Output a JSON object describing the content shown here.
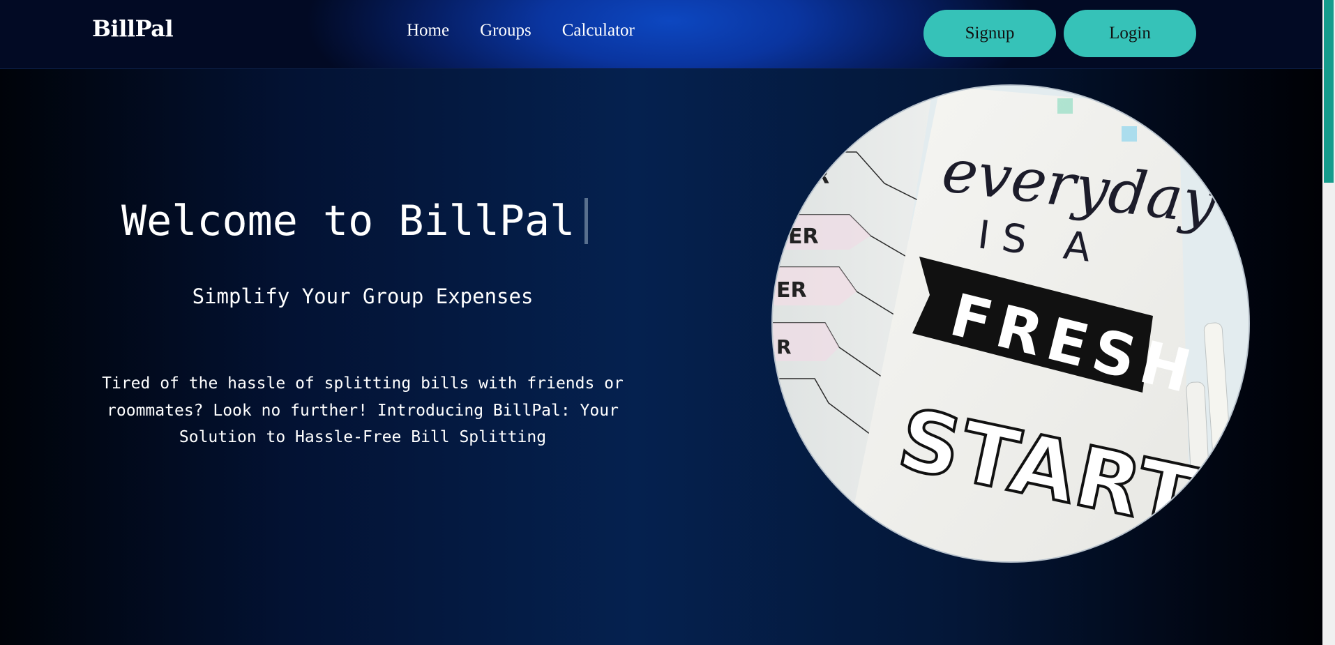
{
  "nav": {
    "brand": "BillPal",
    "links": [
      "Home",
      "Groups",
      "Calculator"
    ],
    "signup_label": "Signup",
    "login_label": "Login"
  },
  "hero": {
    "title": "Welcome to BillPal",
    "subtitle": "Simplify Your Group Expenses",
    "description": "Tired of the hassle of splitting bills with friends or roommates? Look no further! Introducing BillPal: Your Solution to Hassle-Free Bill Splitting",
    "image_text": {
      "line1": "everyday",
      "line2": "IS A",
      "line3": "FRESH",
      "line4": "START"
    }
  },
  "colors": {
    "accent": "#36c2b8",
    "nav_glow": "#0d47c0",
    "background": "#031233",
    "scroll_thumb": "#169c8c"
  },
  "icons": {
    "text_cursor": "text-cursor-icon"
  }
}
